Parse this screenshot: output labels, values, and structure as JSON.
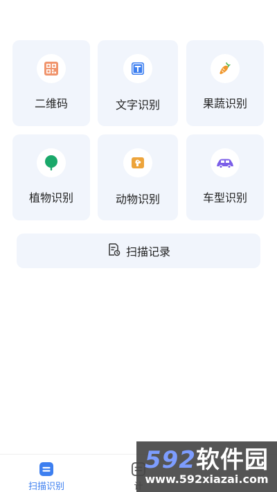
{
  "tiles": [
    {
      "label": "二维码",
      "icon": "qr-code-icon"
    },
    {
      "label": "文字识别",
      "icon": "text-t-icon"
    },
    {
      "label": "果蔬识别",
      "icon": "carrot-icon"
    },
    {
      "label": "植物识别",
      "icon": "tree-icon"
    },
    {
      "label": "动物识别",
      "icon": "dog-icon"
    },
    {
      "label": "车型识别",
      "icon": "car-icon"
    }
  ],
  "record": {
    "label": "扫描记录",
    "icon": "history-document-icon"
  },
  "tabbar": {
    "tabs": [
      {
        "label": "扫描识别",
        "active": true,
        "icon": "scan-tab-icon"
      },
      {
        "label": "计",
        "active": false,
        "icon": "calculator-tab-icon"
      }
    ]
  },
  "watermark": {
    "brand_num": "592",
    "brand_text": "软件园",
    "url": "www.592xiazai.com"
  },
  "colors": {
    "tile_bg": "#f1f5fc",
    "accent_blue": "#3d7ff0",
    "carrot": "#f0962b",
    "tree": "#1aa86a",
    "dog": "#eda43b",
    "car": "#7b5ee8"
  }
}
